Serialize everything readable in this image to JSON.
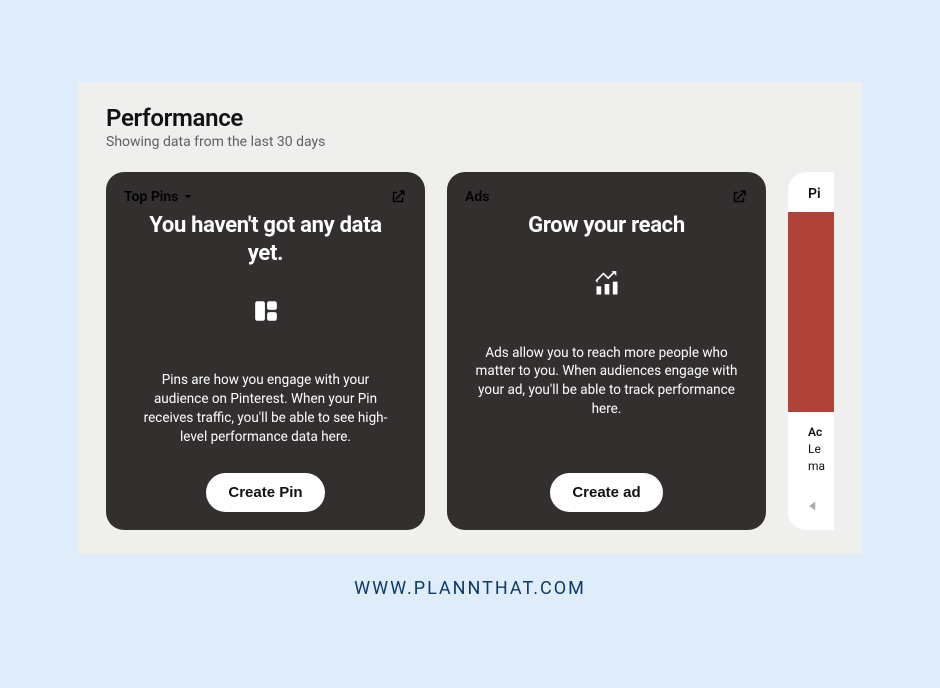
{
  "header": {
    "title": "Performance",
    "subtitle": "Showing data from the last 30 days"
  },
  "cards": {
    "top_pins": {
      "label": "Top Pins",
      "title": "You haven't got any data yet.",
      "description": "Pins are how you engage with your audience on Pinterest. When your Pin receives traffic, you'll be able to see high-level performance data here.",
      "button": "Create Pin"
    },
    "ads": {
      "label": "Ads",
      "title": "Grow your reach",
      "description": "Ads allow you to reach more people who matter to you. When audiences engage with your ad, you'll be able to track performance here.",
      "button": "Create ad"
    },
    "peek": {
      "label": "Pi",
      "line1": "Ac",
      "line2": "Le",
      "line3": "ma"
    }
  },
  "footer": {
    "url": "WWW.PLANNTHAT.COM"
  }
}
